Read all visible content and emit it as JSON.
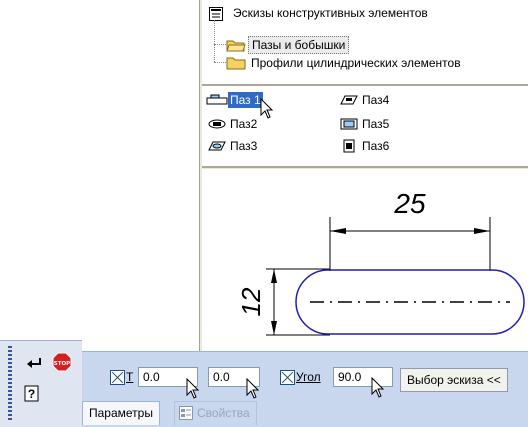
{
  "tree": {
    "root_label": "Эскизы конструктивных элементов",
    "children": [
      {
        "label": "Пазы и бобышки",
        "selected": true
      },
      {
        "label": "Профили цилиндрических элементов",
        "selected": false
      }
    ]
  },
  "items": [
    {
      "label": "Паз 1",
      "selected": true,
      "icon": "slot-sketch-icon"
    },
    {
      "label": "Паз2",
      "selected": false,
      "icon": "slot-sketch-icon"
    },
    {
      "label": "Паз3",
      "selected": false,
      "icon": "slot-sketch-icon"
    },
    {
      "label": "Паз4",
      "selected": false,
      "icon": "slot-sketch-icon"
    },
    {
      "label": "Паз5",
      "selected": false,
      "icon": "slot-sketch-icon"
    },
    {
      "label": "Паз6",
      "selected": false,
      "icon": "slot-sketch-icon"
    }
  ],
  "preview": {
    "width_dim": "25",
    "height_dim": "12"
  },
  "params": {
    "t_label": "T",
    "t_value": "0.0",
    "second_value": "0.0",
    "angle_label": "Угол",
    "angle_value": "90.0",
    "choose_button": "Выбор эскиза  <<"
  },
  "tabs": {
    "parameters": "Параметры",
    "properties": "Свойства"
  },
  "colors": {
    "selection": "#316ac5",
    "preview_outline": "#1e1eb4",
    "toolbar_bg": "#c9d7ee"
  }
}
